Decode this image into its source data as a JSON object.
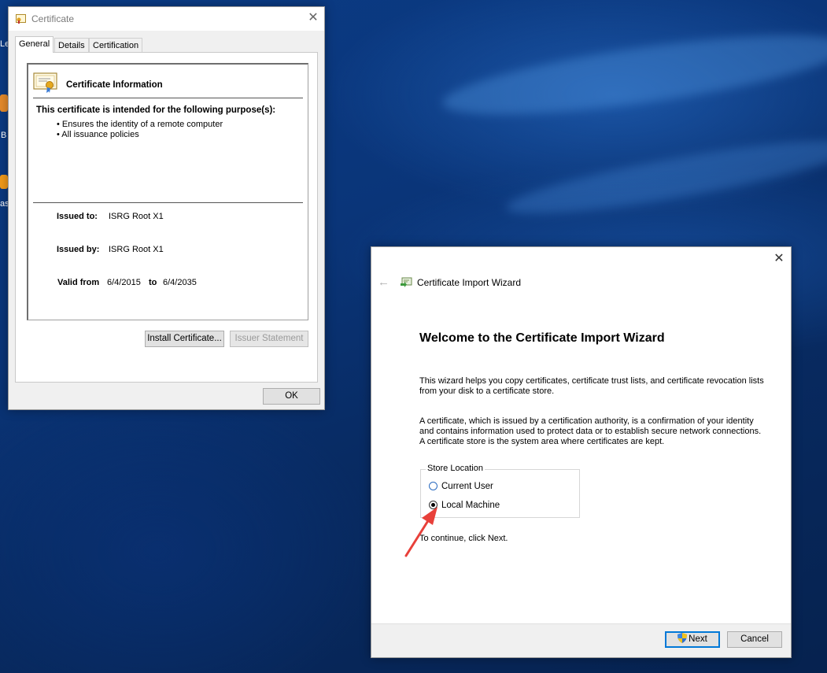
{
  "desktop": {
    "icon_fragments": [
      "Le",
      "B",
      "as"
    ]
  },
  "certificate_dialog": {
    "title": "Certificate",
    "close_glyph": "✕",
    "tabs": [
      {
        "label": "General",
        "active": true
      },
      {
        "label": "Details",
        "active": false
      },
      {
        "label": "Certification Path",
        "active": false
      }
    ],
    "info_heading": "Certificate Information",
    "purpose_heading": "This certificate is intended for the following purpose(s):",
    "purposes": [
      "• Ensures the identity of a remote computer",
      "• All issuance policies"
    ],
    "issued_to_label": "Issued to:",
    "issued_to_value": "ISRG Root X1",
    "issued_by_label": "Issued by:",
    "issued_by_value": "ISRG Root X1",
    "valid_from_label": "Valid from",
    "valid_from_value": "6/4/2015",
    "valid_to_label": "to",
    "valid_to_value": "6/4/2035",
    "install_button": "Install Certificate...",
    "issuer_statement_button": "Issuer Statement",
    "ok_button": "OK"
  },
  "import_wizard": {
    "close_glyph": "✕",
    "back_glyph": "←",
    "title": "Certificate Import Wizard",
    "heading": "Welcome to the Certificate Import Wizard",
    "paragraph1": "This wizard helps you copy certificates, certificate trust lists, and certificate revocation lists from your disk to a certificate store.",
    "paragraph2": "A certificate, which is issued by a certification authority, is a confirmation of your identity and contains information used to protect data or to establish secure network connections. A certificate store is the system area where certificates are kept.",
    "store_location_label": "Store Location",
    "options": [
      {
        "label": "Current User",
        "selected": false
      },
      {
        "label": "Local Machine",
        "selected": true
      }
    ],
    "continue_text": "To continue, click Next.",
    "next_button": "Next",
    "cancel_button": "Cancel"
  },
  "annotation": {
    "arrow_color": "#e8403a"
  }
}
